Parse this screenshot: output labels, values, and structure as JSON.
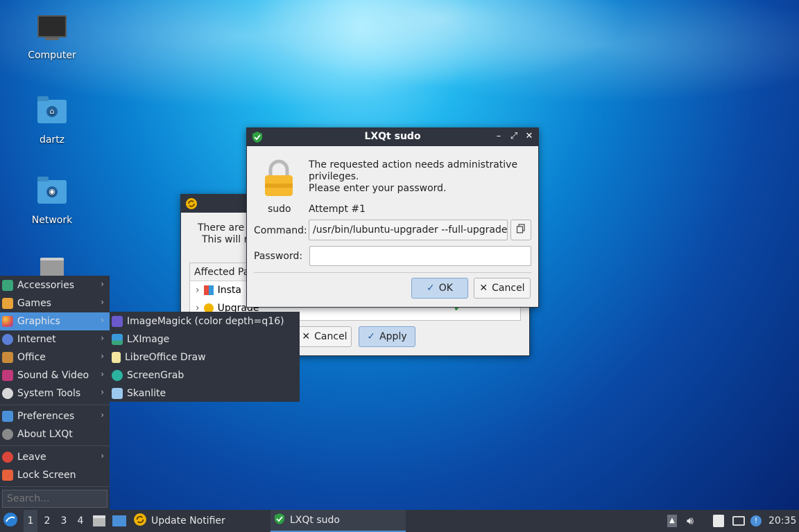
{
  "desktop": {
    "icons": [
      {
        "label": "Computer"
      },
      {
        "label": "dartz"
      },
      {
        "label": "Network"
      }
    ]
  },
  "update_window": {
    "text_line1": "There are u",
    "text_line2": "This will r",
    "table_header": "Affected Pa",
    "rows": [
      "Insta",
      "Upgrade"
    ],
    "cancel_label": "Cancel",
    "apply_label": "Apply"
  },
  "sudo_dialog": {
    "title": "LXQt sudo",
    "message_line1": "The requested action needs administrative",
    "message_line2": "privileges.",
    "message_line3": "Please enter your password.",
    "user": "sudo",
    "attempt": "Attempt #1",
    "command_label": "Command:",
    "command_value": "/usr/bin/lubuntu-upgrader --full-upgrade",
    "password_label": "Password:",
    "password_value": "",
    "ok_label": "OK",
    "cancel_label": "Cancel"
  },
  "main_menu": {
    "items": [
      {
        "label": "Accessories",
        "icon": "accessories-icon",
        "color": "#3aa57a"
      },
      {
        "label": "Games",
        "icon": "games-icon",
        "color": "#e8a33a"
      },
      {
        "label": "Graphics",
        "icon": "graphics-icon",
        "color": "#d9534f"
      },
      {
        "label": "Internet",
        "icon": "internet-icon",
        "color": "#5b7fd6"
      },
      {
        "label": "Office",
        "icon": "office-icon",
        "color": "#c98a3a"
      },
      {
        "label": "Sound & Video",
        "icon": "sound-video-icon",
        "color": "#c0397a"
      },
      {
        "label": "System Tools",
        "icon": "system-tools-icon",
        "color": "#d8d8d8"
      },
      {
        "label": "Preferences",
        "icon": "preferences-icon",
        "color": "#4a90d9"
      },
      {
        "label": "About LXQt",
        "icon": "about-icon",
        "color": "#8a8a8a"
      },
      {
        "label": "Leave",
        "icon": "leave-icon",
        "color": "#d9463b"
      },
      {
        "label": "Lock Screen",
        "icon": "lock-icon",
        "color": "#e5603b"
      }
    ],
    "search_placeholder": "Search..."
  },
  "graphics_submenu": {
    "items": [
      {
        "label": "ImageMagick (color depth=q16)",
        "icon": "imagemagick-icon",
        "color": "#6a5acd"
      },
      {
        "label": "LXImage",
        "icon": "lximage-icon",
        "color": "#3a9ad9"
      },
      {
        "label": "LibreOffice Draw",
        "icon": "libreoffice-draw-icon",
        "color": "#f2e6a0"
      },
      {
        "label": "ScreenGrab",
        "icon": "screengrab-icon",
        "color": "#2bb3a0"
      },
      {
        "label": "Skanlite",
        "icon": "skanlite-icon",
        "color": "#9cc9ef"
      }
    ]
  },
  "taskbar": {
    "workspaces": [
      "1",
      "2",
      "3",
      "4"
    ],
    "tasks": [
      {
        "label": "Update Notifier"
      },
      {
        "label": "LXQt sudo"
      }
    ],
    "clock": "20:35"
  }
}
